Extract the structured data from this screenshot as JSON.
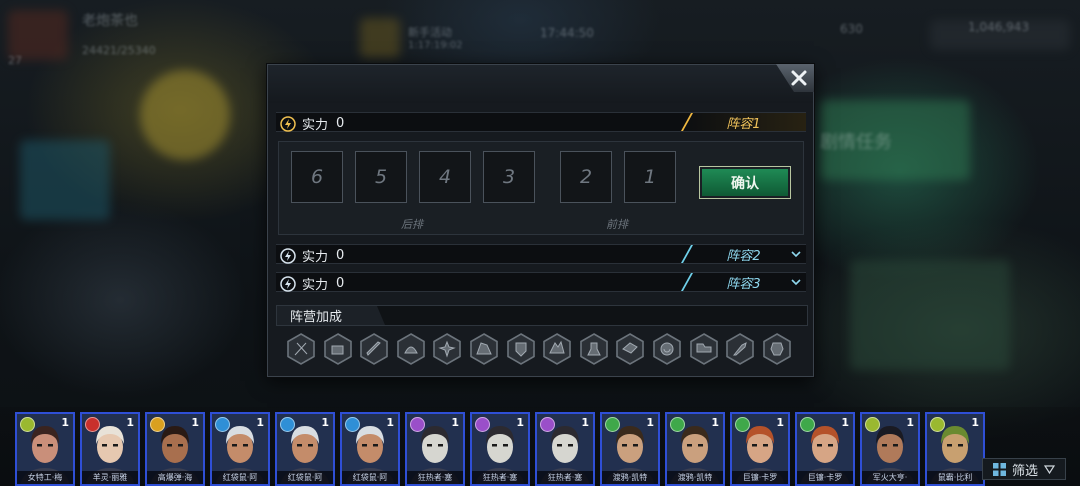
{
  "background": {
    "player_name": "老炮茶也",
    "exp_text": "24421/25340",
    "level_text": "27",
    "event_label": "新手活动",
    "event_timer": "1:17:19:02",
    "clock": "17:44:50",
    "energy": "630",
    "gold": "1,046,943",
    "side_text": "剧情任务"
  },
  "dialog": {
    "lineups": [
      {
        "power_label": "实力",
        "power_value": "0",
        "tag": "阵容1",
        "active": true
      },
      {
        "power_label": "实力",
        "power_value": "0",
        "tag": "阵容2",
        "active": false
      },
      {
        "power_label": "实力",
        "power_value": "0",
        "tag": "阵容3",
        "active": false
      }
    ],
    "slots": [
      "6",
      "5",
      "4",
      "3",
      "2",
      "1"
    ],
    "back_row_label": "后排",
    "front_row_label": "前排",
    "confirm_label": "确认",
    "faction_label": "阵营加成",
    "faction_icons": [
      "sword-faction-icon",
      "fist-faction-icon",
      "blade-faction-icon",
      "beast-faction-icon",
      "gear-faction-icon",
      "wolf-faction-icon",
      "shield-faction-icon",
      "claw-faction-icon",
      "soldier-faction-icon",
      "bird-faction-icon",
      "spiral-faction-icon",
      "tank-faction-icon",
      "axe-faction-icon",
      "mech-faction-icon"
    ]
  },
  "heroes": [
    {
      "name": "女特工·梅",
      "level": "1",
      "badge_color": "#9ab830",
      "skin": "#c98f7a",
      "hair": "#3a2420"
    },
    {
      "name": "羊灵·丽雅",
      "level": "1",
      "badge_color": "#c9302c",
      "skin": "#e6c8b0",
      "hair": "#e8e2d8"
    },
    {
      "name": "高爆弹·海",
      "level": "1",
      "badge_color": "#d9a020",
      "skin": "#a86f4e",
      "hair": "#2a1a14"
    },
    {
      "name": "红袋鼠·阿",
      "level": "1",
      "badge_color": "#2f8fd6",
      "skin": "#c48c6a",
      "hair": "#d8dde2"
    },
    {
      "name": "红袋鼠·阿",
      "level": "1",
      "badge_color": "#2f8fd6",
      "skin": "#c48c6a",
      "hair": "#d8dde2"
    },
    {
      "name": "红袋鼠·阿",
      "level": "1",
      "badge_color": "#2f8fd6",
      "skin": "#c48c6a",
      "hair": "#d8dde2"
    },
    {
      "name": "狂热者·塞",
      "level": "1",
      "badge_color": "#9a4fc9",
      "skin": "#d6d6d0",
      "hair": "#2c2a30"
    },
    {
      "name": "狂热者·塞",
      "level": "1",
      "badge_color": "#9a4fc9",
      "skin": "#d6d6d0",
      "hair": "#2c2a30"
    },
    {
      "name": "狂热者·塞",
      "level": "1",
      "badge_color": "#9a4fc9",
      "skin": "#d6d6d0",
      "hair": "#2c2a30"
    },
    {
      "name": "渡鸦·凯特",
      "level": "1",
      "badge_color": "#3fa84a",
      "skin": "#caa07e",
      "hair": "#3a2a1c"
    },
    {
      "name": "渡鸦·凯特",
      "level": "1",
      "badge_color": "#3fa84a",
      "skin": "#caa07e",
      "hair": "#3a2a1c"
    },
    {
      "name": "巨镰·卡罗",
      "level": "1",
      "badge_color": "#3fa84a",
      "skin": "#d6a585",
      "hair": "#b5522a"
    },
    {
      "name": "巨镰·卡罗",
      "level": "1",
      "badge_color": "#3fa84a",
      "skin": "#d6a585",
      "hair": "#b5522a"
    },
    {
      "name": "军火大亨·",
      "level": "1",
      "badge_color": "#9ab830",
      "skin": "#b07a5a",
      "hair": "#1a1a22"
    },
    {
      "name": "鼠霸·比利",
      "level": "1",
      "badge_color": "#9ab830",
      "skin": "#c8a070",
      "hair": "#6a8a30"
    }
  ],
  "filter_label": "筛选"
}
